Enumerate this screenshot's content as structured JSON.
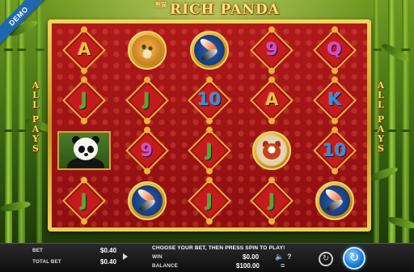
{
  "demo_label": "DEMO",
  "logo": {
    "cn": "熊猫",
    "title": "RICH PANDA"
  },
  "side_text": {
    "left": [
      "A",
      "L",
      "L",
      " ",
      "P",
      "A",
      "Y",
      "S"
    ],
    "right": [
      "A",
      "L",
      "L",
      " ",
      "P",
      "A",
      "Y",
      "S"
    ]
  },
  "reels": [
    [
      {
        "symbol": "A",
        "color": "#f4c23a"
      },
      {
        "symbol": "J",
        "color": "#47b02c"
      },
      {
        "symbol": "panda"
      },
      {
        "symbol": "J",
        "color": "#47b02c"
      }
    ],
    [
      {
        "symbol": "leopard"
      },
      {
        "symbol": "J",
        "color": "#47b02c"
      },
      {
        "symbol": "9",
        "color": "#d04ad8"
      },
      {
        "symbol": "koi"
      }
    ],
    [
      {
        "symbol": "koi"
      },
      {
        "symbol": "10",
        "color": "#2f8fe0"
      },
      {
        "symbol": "J",
        "color": "#47b02c"
      },
      {
        "symbol": "J",
        "color": "#47b02c"
      }
    ],
    [
      {
        "symbol": "9",
        "color": "#d04ad8"
      },
      {
        "symbol": "A",
        "color": "#f4c23a"
      },
      {
        "symbol": "red-panda"
      },
      {
        "symbol": "J",
        "color": "#47b02c"
      }
    ],
    [
      {
        "symbol": "Q",
        "color": "#d04ad8"
      },
      {
        "symbol": "K",
        "color": "#2f8fe0"
      },
      {
        "symbol": "10",
        "color": "#2f8fe0"
      },
      {
        "symbol": "koi"
      }
    ]
  ],
  "bottom_bar": {
    "bet_label": "BET",
    "bet_value": "$0.40",
    "total_bet_label": "TOTAL BET",
    "total_bet_value": "$0.40",
    "message": "CHOOSE YOUR BET, THEN PRESS SPIN TO PLAY!",
    "win_label": "WIN",
    "win_value": "$0.00",
    "balance_label": "BALANCE",
    "balance_value": "$100.00",
    "sound_icon": "speaker-icon",
    "help_label": "?",
    "menu_icon": "hamburger-icon",
    "autoplay_icon": "autoplay-icon",
    "spin_icon": "spin-icon"
  }
}
